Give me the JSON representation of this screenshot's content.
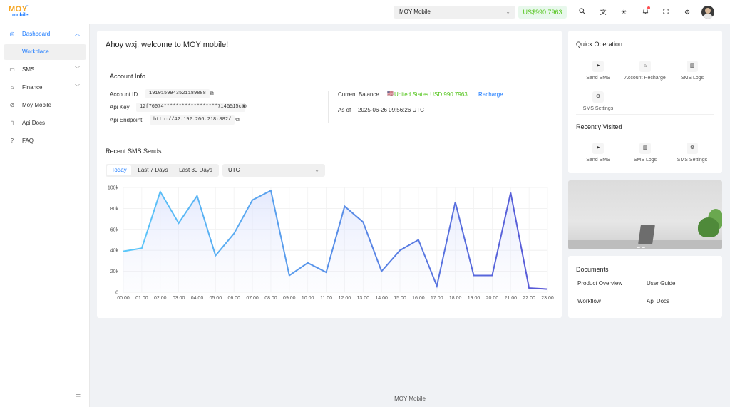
{
  "topbar": {
    "logo_text": "MOY",
    "logo_sub": "mobile",
    "account_select": "MOY Mobile",
    "balance": "US$990.7963",
    "icons": [
      "search-icon",
      "translate-icon",
      "theme-icon",
      "bell-icon",
      "fullscreen-icon",
      "settings-icon",
      "avatar"
    ]
  },
  "sidebar": {
    "items": [
      {
        "label": "Dashboard",
        "icon": "dashboard-icon",
        "expanded": true
      },
      {
        "label": "Workplace"
      },
      {
        "label": "SMS",
        "icon": "sms-icon"
      },
      {
        "label": "Finance",
        "icon": "finance-icon"
      },
      {
        "label": "Moy Mobile",
        "icon": "link-icon"
      },
      {
        "label": "Api Docs",
        "icon": "doc-icon"
      },
      {
        "label": "FAQ",
        "icon": "question-icon"
      }
    ]
  },
  "main": {
    "welcome": "Ahoy wxj, welcome to MOY mobile!",
    "account_info_title": "Account Info",
    "account_id_label": "Account ID",
    "account_id": "1910159943521189888",
    "api_key_label": "Api Key",
    "api_key": "12f76074******************7146515c",
    "api_endpoint_label": "Api Endpoint",
    "api_endpoint": "http://42.192.206.218:882/",
    "current_balance_label": "Current Balance",
    "current_balance_value": "United States USD 990.7963",
    "recharge_label": "Recharge",
    "as_of_label": "As of",
    "as_of_value": "2025-06-26 09:56:26 UTC",
    "recent_title": "Recent SMS Sends",
    "range_tabs": [
      "Today",
      "Last 7 Days",
      "Last 30 Days"
    ],
    "active_range": "Today",
    "timezone": "UTC"
  },
  "chart_data": {
    "type": "area",
    "x": [
      "00:00",
      "01:00",
      "02:00",
      "03:00",
      "04:00",
      "05:00",
      "06:00",
      "07:00",
      "08:00",
      "09:00",
      "10:00",
      "11:00",
      "12:00",
      "13:00",
      "14:00",
      "15:00",
      "16:00",
      "17:00",
      "18:00",
      "19:00",
      "20:00",
      "21:00",
      "22:00",
      "23:00"
    ],
    "y_ticks": [
      "0",
      "20k",
      "40k",
      "60k",
      "80k",
      "100k"
    ],
    "ylim": [
      0,
      100000
    ],
    "series": [
      {
        "values": [
          39000,
          42000,
          96000,
          66000,
          92000,
          35000,
          56000,
          88000,
          97000,
          16000,
          28000,
          19000,
          82000,
          67000,
          20000,
          40000,
          50000,
          6000,
          86000,
          16000,
          16000,
          95000,
          4000,
          3000
        ]
      }
    ],
    "grid": true,
    "gradient": [
      "#5ac8fa",
      "#5856d6"
    ]
  },
  "quick_operation": {
    "title": "Quick Operation",
    "items": [
      {
        "label": "Send SMS",
        "icon": "send-icon"
      },
      {
        "label": "Account Recharge",
        "icon": "wallet-icon"
      },
      {
        "label": "SMS Logs",
        "icon": "bar-chart-icon"
      },
      {
        "label": "SMS Settings",
        "icon": "gear-icon"
      }
    ]
  },
  "recently_visited": {
    "title": "Recently Visited",
    "items": [
      {
        "label": "Send SMS",
        "icon": "send-icon"
      },
      {
        "label": "SMS Logs",
        "icon": "bar-chart-icon"
      },
      {
        "label": "SMS Settings",
        "icon": "gear-icon"
      }
    ]
  },
  "documents": {
    "title": "Documents",
    "links": [
      "Product Overview",
      "User Guide",
      "Workflow",
      "Api Docs"
    ]
  },
  "footer": "MOY Mobile"
}
